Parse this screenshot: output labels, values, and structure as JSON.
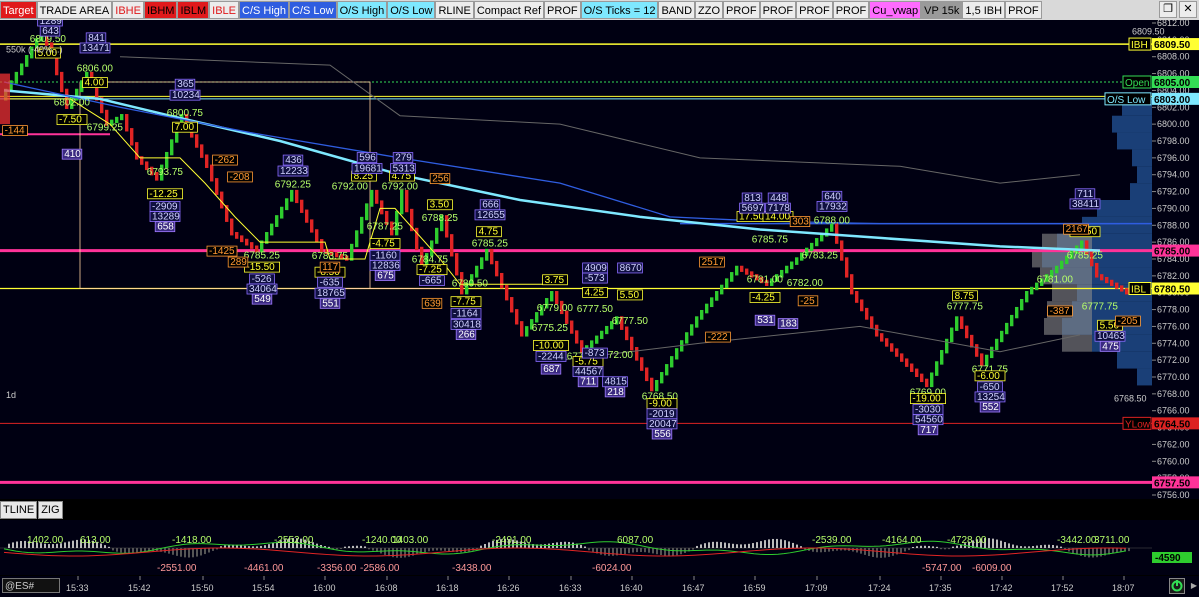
{
  "toolbar": {
    "buttons": [
      {
        "label": "Target",
        "bg": "#e0191b",
        "fg": "#ffffff"
      },
      {
        "label": "TRADE AREA",
        "bg": "#ececec",
        "fg": "#000000"
      },
      {
        "label": "IBHE",
        "bg": "#ececec",
        "fg": "#e0191b"
      },
      {
        "label": "IBHM",
        "bg": "#e0191b",
        "fg": "#000000"
      },
      {
        "label": "IBLM",
        "bg": "#e0191b",
        "fg": "#000000"
      },
      {
        "label": "IBLE",
        "bg": "#ececec",
        "fg": "#e0191b"
      },
      {
        "label": "C/S High",
        "bg": "#2f5de0",
        "fg": "#ffffff"
      },
      {
        "label": "C/S Low",
        "bg": "#2f5de0",
        "fg": "#ffffff"
      },
      {
        "label": "O/S High",
        "bg": "#7ee8ff",
        "fg": "#000000"
      },
      {
        "label": "O/S Low",
        "bg": "#7ee8ff",
        "fg": "#000000"
      },
      {
        "label": "RLINE",
        "bg": "#ececec",
        "fg": "#000000"
      },
      {
        "label": "Compact Ref",
        "bg": "#ececec",
        "fg": "#000000"
      },
      {
        "label": "PROF",
        "bg": "#ececec",
        "fg": "#000000"
      },
      {
        "label": "O/S Ticks = 12",
        "bg": "#7ee8ff",
        "fg": "#000000"
      },
      {
        "label": "BAND",
        "bg": "#ececec",
        "fg": "#000000"
      },
      {
        "label": "ZZO",
        "bg": "#ececec",
        "fg": "#000000"
      },
      {
        "label": "PROF",
        "bg": "#ececec",
        "fg": "#000000"
      },
      {
        "label": "PROF",
        "bg": "#ececec",
        "fg": "#000000"
      },
      {
        "label": "PROF",
        "bg": "#ececec",
        "fg": "#000000"
      },
      {
        "label": "PROF",
        "bg": "#ececec",
        "fg": "#000000"
      },
      {
        "label": "Cu_vwap",
        "bg": "#ff6bff",
        "fg": "#000000"
      },
      {
        "label": "VP 15k",
        "bg": "#9a9a9a",
        "fg": "#000000"
      },
      {
        "label": "1,5 IBH",
        "bg": "#ececec",
        "fg": "#000000"
      },
      {
        "label": "PROF",
        "bg": "#ececec",
        "fg": "#000000"
      }
    ]
  },
  "price_axis": {
    "ticks": [
      "6812.00",
      "6810.00",
      "6808.00",
      "6806.00",
      "6804.00",
      "6802.00",
      "6800.00",
      "6798.00",
      "6796.00",
      "6794.00",
      "6792.00",
      "6790.00",
      "6788.00",
      "6786.00",
      "6784.00",
      "6782.00",
      "6780.00",
      "6778.00",
      "6776.00",
      "6774.00",
      "6772.00",
      "6770.00",
      "6768.00",
      "6766.00",
      "6764.00",
      "6762.00",
      "6760.00",
      "6758.00",
      "6756.00"
    ],
    "top_note": "6809.50",
    "bottom_note": "6768.50"
  },
  "level_tags": [
    {
      "label": "IBH",
      "price": "6809.50",
      "color": "#ffff33"
    },
    {
      "label": "Open",
      "price": "6805.00",
      "color": "#33dd55"
    },
    {
      "label": "O/S Low",
      "price": "6803.00",
      "color": "#7ee8ff"
    },
    {
      "label": "",
      "price": "6785.00",
      "color": "#ff3399"
    },
    {
      "label": "IBL",
      "price": "6780.50",
      "color": "#ffff33"
    },
    {
      "label": "YLow",
      "price": "6764.50",
      "color": "#dd2222"
    },
    {
      "label": "",
      "price": "6757.50",
      "color": "#ff3399"
    }
  ],
  "swing_labels": [
    {
      "text": "6809.50",
      "c": "#ffff33"
    },
    {
      "text": "6806.00",
      "c": "#ffff33"
    },
    {
      "text": "6802.00",
      "c": "#ffff33"
    },
    {
      "text": "6799.25",
      "c": "#ffff33"
    },
    {
      "text": "6800.75",
      "c": "#ffff33"
    },
    {
      "text": "6793.75",
      "c": "#ffff33"
    },
    {
      "text": "6792.25",
      "c": "#ffff33"
    },
    {
      "text": "6792.00",
      "c": "#ffff33"
    },
    {
      "text": "6792.00",
      "c": "#ffff33"
    },
    {
      "text": "6788.25",
      "c": "#ffff33"
    },
    {
      "text": "6787.25",
      "c": "#ffff33"
    },
    {
      "text": "6785.25",
      "c": "#ffff33"
    },
    {
      "text": "6785.25",
      "c": "#ffff33"
    },
    {
      "text": "6783.75",
      "c": "#ffff33"
    },
    {
      "text": "6784.75",
      "c": "#ffff33"
    },
    {
      "text": "6780.50",
      "c": "#ffff33"
    },
    {
      "text": "6779.00",
      "c": "#ffff33"
    },
    {
      "text": "6777.50",
      "c": "#ffff33"
    },
    {
      "text": "6777.50",
      "c": "#ffff33"
    },
    {
      "text": "6775.25",
      "c": "#ffff33"
    },
    {
      "text": "6773.25",
      "c": "#ffff33"
    },
    {
      "text": "6772.00",
      "c": "#ffff33"
    },
    {
      "text": "6768.50",
      "c": "#ffff33"
    },
    {
      "text": "6781.00",
      "c": "#ffff33"
    },
    {
      "text": "6782.00",
      "c": "#ffff33"
    },
    {
      "text": "6785.75",
      "c": "#ffff33"
    },
    {
      "text": "6783.25",
      "c": "#ffff33"
    },
    {
      "text": "6788.00",
      "c": "#ffff33"
    },
    {
      "text": "6769.00",
      "c": "#ffff33"
    },
    {
      "text": "6777.75",
      "c": "#ffff33"
    },
    {
      "text": "6771.75",
      "c": "#ffff33"
    },
    {
      "text": "6781.00",
      "c": "#ffff33"
    },
    {
      "text": "6785.25",
      "c": "#ffff33"
    },
    {
      "text": "6777.75",
      "c": "#ffff33"
    }
  ],
  "delta_labels": [
    {
      "text": "-12.25",
      "c": "#ffff33"
    },
    {
      "text": "-15.50",
      "c": "#ffff33"
    },
    {
      "text": "-8.50",
      "c": "#ffff33"
    },
    {
      "text": "-4.75",
      "c": "#ffff33"
    },
    {
      "text": "-7.25",
      "c": "#ffff33"
    },
    {
      "text": "-7.75",
      "c": "#ffff33"
    },
    {
      "text": "-10.00",
      "c": "#ffff33"
    },
    {
      "text": "-5.75",
      "c": "#ffff33"
    },
    {
      "text": "-9.00",
      "c": "#ffff33"
    },
    {
      "text": "-4.25",
      "c": "#ffff33"
    },
    {
      "text": "-19.00",
      "c": "#ffff33"
    },
    {
      "text": "-6.00",
      "c": "#ffff33"
    },
    {
      "text": "7.00",
      "c": "#ffff33"
    },
    {
      "text": "5.00",
      "c": "#ffff33"
    },
    {
      "text": "4.00",
      "c": "#ffff33"
    },
    {
      "text": "8.25",
      "c": "#ffff33"
    },
    {
      "text": "4.75",
      "c": "#ffff33"
    },
    {
      "text": "3.50",
      "c": "#ffff33"
    },
    {
      "text": "4.75",
      "c": "#ffff33"
    },
    {
      "text": "3.75",
      "c": "#ffff33"
    },
    {
      "text": "4.25",
      "c": "#ffff33"
    },
    {
      "text": "5.50",
      "c": "#ffff33"
    },
    {
      "text": "17.50",
      "c": "#ffff33"
    },
    {
      "text": "14.00",
      "c": "#ffff33"
    },
    {
      "text": "8.75",
      "c": "#ffff33"
    },
    {
      "text": "13.50",
      "c": "#ffff33"
    },
    {
      "text": "5.50",
      "c": "#ffff33"
    },
    {
      "text": "-7.50",
      "c": "#ffff33"
    }
  ],
  "volume_labels": [
    "1289",
    "841",
    "13471",
    "643",
    "365",
    "10234",
    "436",
    "12233",
    "596",
    "19681",
    "279",
    "5313",
    "666",
    "12655",
    "-2909",
    "13289",
    "-526",
    "34064",
    "-635",
    "18765",
    "-1160",
    "12836",
    "-665",
    "-1164",
    "30418",
    "4909",
    "8670",
    "-573",
    "-873",
    "44567",
    "4815",
    "-2019",
    "20047",
    "813",
    "5697",
    "448",
    "7178",
    "640",
    "17932",
    "-3030",
    "54560",
    "-650",
    "13254",
    "711",
    "38411",
    "10463",
    "-2244"
  ],
  "volume_neg_labels": [
    "-144",
    "-262",
    "-208",
    "-1425",
    "289",
    "117",
    "256",
    "639",
    "-387",
    "-222",
    "2517",
    "303",
    "2167",
    "-25",
    "-205"
  ],
  "volume_purple": [
    "410",
    "658",
    "549",
    "551",
    "675",
    "266",
    "687",
    "711",
    "218",
    "556",
    "531",
    "183",
    "717",
    "552",
    "475"
  ],
  "chart_notes": {
    "volume_note": "550k (-40%...)",
    "period_label": "1d"
  },
  "time_axis": [
    "15:33",
    "15:42",
    "15:50",
    "15:54",
    "16:00",
    "16:08",
    "16:18",
    "16:26",
    "16:33",
    "16:40",
    "16:47",
    "16:59",
    "17:09",
    "17:24",
    "17:35",
    "17:42",
    "17:52",
    "18:07"
  ],
  "sub_tabs": [
    "TLINE",
    "ZIG"
  ],
  "sub_chart": {
    "value_labels_pos": [
      "1402.00",
      "613.00",
      "-1418.00",
      "-2552.00",
      "-1240.00",
      "1403.00",
      "-2491.00",
      "6087.00",
      "-2539.00",
      "-4164.00",
      "-4728.00",
      "-3442.00",
      "3711.00"
    ],
    "value_labels_neg": [
      "-2551.00",
      "-4461.00",
      "-3356.00",
      "-2586.00",
      "-3438.00",
      "-6024.00",
      "-5747.00",
      "-6009.00"
    ],
    "right_value": "-4590"
  },
  "bottom_bar": {
    "symbol": "@ES#"
  }
}
